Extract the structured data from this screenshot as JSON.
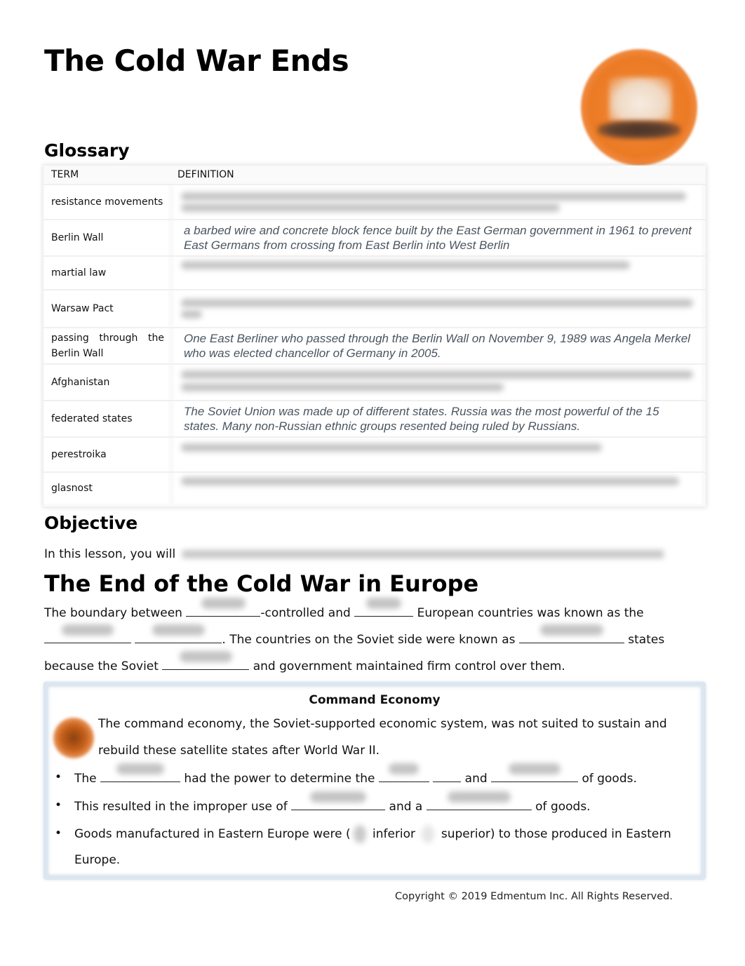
{
  "page": {
    "title": "The Cold War Ends",
    "logo_icon": "ship-logo-icon"
  },
  "glossary": {
    "heading": "Glossary",
    "columns": {
      "term": "TERM",
      "definition": "DEFINITION"
    },
    "rows": [
      {
        "term": "resistance movements",
        "definition": "",
        "definition_obscured": true
      },
      {
        "term": "Berlin Wall",
        "definition": "a barbed wire and concrete block fence built by the East German government in 1961 to prevent East Germans from crossing from East Berlin into West Berlin",
        "definition_obscured": false
      },
      {
        "term": "martial law",
        "definition": "",
        "definition_obscured": true
      },
      {
        "term": "Warsaw Pact",
        "definition": "",
        "definition_obscured": true
      },
      {
        "term": "passing through the Berlin Wall",
        "definition": "One East Berliner who passed through the Berlin Wall on November 9, 1989 was Angela Merkel who was elected chancellor of Germany in 2005.",
        "definition_obscured": false
      },
      {
        "term": "Afghanistan",
        "definition": "",
        "definition_obscured": true
      },
      {
        "term": "federated states",
        "definition": "The Soviet Union was made up of different states. Russia was the most powerful of the 15 states. Many non-Russian ethnic groups resented being ruled by Russians.",
        "definition_obscured": false
      },
      {
        "term": "perestroika",
        "definition": "",
        "definition_obscured": true
      },
      {
        "term": "glasnost",
        "definition": "",
        "definition_obscured": true
      }
    ]
  },
  "objective": {
    "heading": "Objective",
    "lead": "In this lesson, you will"
  },
  "section": {
    "title": "The End of the Cold War in Europe",
    "p1": {
      "a": "The boundary between ",
      "b": "-controlled and ",
      "c": " European countries was known as the"
    },
    "p2": {
      "a": ".  The countries on the Soviet side were known as ",
      "b": " states"
    },
    "p3": {
      "a": "because the Soviet ",
      "b": " and government maintained firm control over them."
    }
  },
  "command_economy": {
    "title": "Command Economy",
    "icon": "info-bubble-icon",
    "intro_line1": "The command economy, the Soviet-supported economic system, was not suited to sustain and",
    "intro_line2": "rebuild these satellite states after World War II.",
    "bullets": [
      {
        "a": "The ",
        "b": " had the power to determine the ",
        "c": " and ",
        "d": " of goods."
      },
      {
        "a": "This resulted in the improper use of ",
        "b": " and a ",
        "c": " of goods."
      },
      {
        "a": "Goods manufactured in Eastern Europe were (",
        "b": " inferior ",
        "c": " superior) to those produced in Eastern",
        "d": "Europe."
      }
    ],
    "bullet_glyph": "•"
  },
  "footer": {
    "copyright": "Copyright © 2019 Edmentum Inc. All Rights Reserved."
  }
}
